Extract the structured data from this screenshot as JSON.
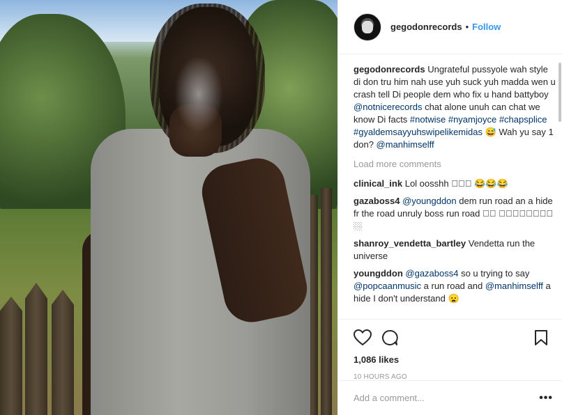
{
  "header": {
    "username": "gegodonrecords",
    "dot": "•",
    "follow_label": "Follow"
  },
  "caption": {
    "username": "gegodonrecords",
    "text_1": "Ungrateful pussyole wah style di don tru him nah use yuh suck yuh madda wen u crash tell Di people dem who fix u hand battyboy ",
    "mention_1": "@notnicerecords",
    "text_2": " chat alone unuh can chat we know Di facts ",
    "tags": "#notwise #nyamjoyce #chapsplice #gyaldemsayyuhswipelikemidas",
    "text_3": " 😅 Wah yu say 1 don? ",
    "mention_2": "@manhimselff"
  },
  "load_more": "Load more comments",
  "comments": [
    {
      "user": "clinical_ink",
      "text": "Lol oosshh 🏼🏼🏼 😂😂😂"
    },
    {
      "user": "gazaboss4",
      "mention": "@youngddon",
      "text": " dem run road an a hide fr the road unruly boss run road 🏼🏼 🏼🏼🏼🏼🏼🏼🏼🏼🏼"
    },
    {
      "user": "shanroy_vendetta_bartley",
      "text": "Vendetta run the universe"
    },
    {
      "user": "youngddon",
      "mention_1": "@gazaboss4",
      "text_1": " so u trying to say ",
      "mention_2": "@popcaanmusic",
      "text_2": " a run road and ",
      "mention_3": "@manhimselff",
      "text_3": " a hide I don't understand 😦"
    }
  ],
  "icons": {
    "like": "heart-icon",
    "comment": "comment-icon",
    "save": "bookmark-icon",
    "options": "more-options-icon"
  },
  "likes": "1,086 likes",
  "time": "10 HOURS AGO",
  "add_comment": {
    "placeholder": "Add a comment..."
  },
  "options_glyph": "•••"
}
